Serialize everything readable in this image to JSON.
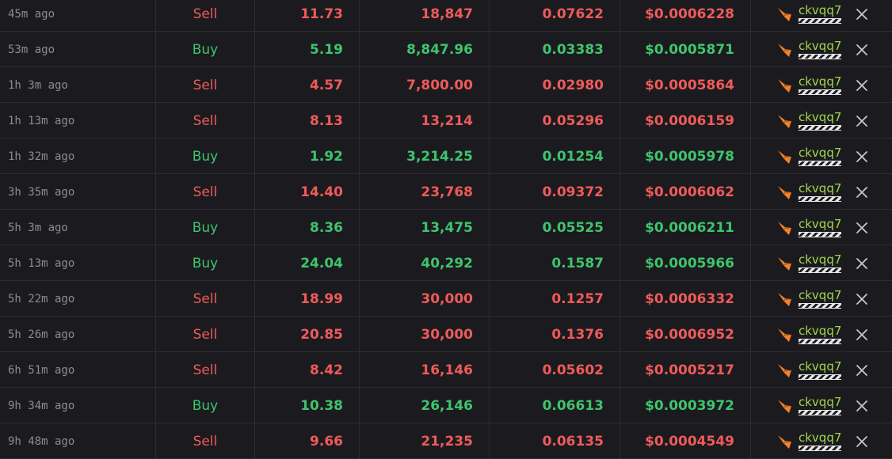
{
  "colors": {
    "sell": "#f05a5a",
    "buy": "#3ec46d",
    "maker": "#a2d64c",
    "maker_icon": "#f5822a"
  },
  "trades": [
    {
      "time": "45m ago",
      "type": "Sell",
      "usd": "11.73",
      "tokens": "18,847",
      "sol": "0.07622",
      "price": "$0.0006228",
      "maker": "ckvqq7"
    },
    {
      "time": "53m ago",
      "type": "Buy",
      "usd": "5.19",
      "tokens": "8,847.96",
      "sol": "0.03383",
      "price": "$0.0005871",
      "maker": "ckvqq7"
    },
    {
      "time": "1h 3m ago",
      "type": "Sell",
      "usd": "4.57",
      "tokens": "7,800.00",
      "sol": "0.02980",
      "price": "$0.0005864",
      "maker": "ckvqq7"
    },
    {
      "time": "1h 13m ago",
      "type": "Sell",
      "usd": "8.13",
      "tokens": "13,214",
      "sol": "0.05296",
      "price": "$0.0006159",
      "maker": "ckvqq7"
    },
    {
      "time": "1h 32m ago",
      "type": "Buy",
      "usd": "1.92",
      "tokens": "3,214.25",
      "sol": "0.01254",
      "price": "$0.0005978",
      "maker": "ckvqq7"
    },
    {
      "time": "3h 35m ago",
      "type": "Sell",
      "usd": "14.40",
      "tokens": "23,768",
      "sol": "0.09372",
      "price": "$0.0006062",
      "maker": "ckvqq7"
    },
    {
      "time": "5h 3m ago",
      "type": "Buy",
      "usd": "8.36",
      "tokens": "13,475",
      "sol": "0.05525",
      "price": "$0.0006211",
      "maker": "ckvqq7"
    },
    {
      "time": "5h 13m ago",
      "type": "Buy",
      "usd": "24.04",
      "tokens": "40,292",
      "sol": "0.1587",
      "price": "$0.0005966",
      "maker": "ckvqq7"
    },
    {
      "time": "5h 22m ago",
      "type": "Sell",
      "usd": "18.99",
      "tokens": "30,000",
      "sol": "0.1257",
      "price": "$0.0006332",
      "maker": "ckvqq7"
    },
    {
      "time": "5h 26m ago",
      "type": "Sell",
      "usd": "20.85",
      "tokens": "30,000",
      "sol": "0.1376",
      "price": "$0.0006952",
      "maker": "ckvqq7"
    },
    {
      "time": "6h 51m ago",
      "type": "Sell",
      "usd": "8.42",
      "tokens": "16,146",
      "sol": "0.05602",
      "price": "$0.0005217",
      "maker": "ckvqq7"
    },
    {
      "time": "9h 34m ago",
      "type": "Buy",
      "usd": "10.38",
      "tokens": "26,146",
      "sol": "0.06613",
      "price": "$0.0003972",
      "maker": "ckvqq7"
    },
    {
      "time": "9h 48m ago",
      "type": "Sell",
      "usd": "9.66",
      "tokens": "21,235",
      "sol": "0.06135",
      "price": "$0.0004549",
      "maker": "ckvqq7"
    }
  ]
}
